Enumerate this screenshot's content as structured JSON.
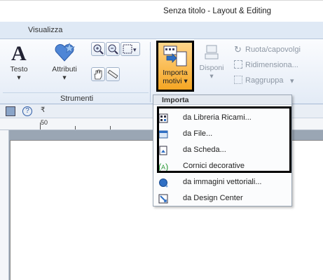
{
  "window": {
    "title": "Senza titolo - Layout & Editing"
  },
  "tabs": {
    "active": "Visualizza"
  },
  "ribbon": {
    "strumenti": {
      "group_label": "Strumenti",
      "testo_label": "Testo",
      "attributi_label": "Attributi"
    },
    "importa": {
      "label_line1": "Importa",
      "label_line2": "motivi"
    },
    "disponi": {
      "label": "Disponi"
    },
    "ruota_label": "Ruota/capovolgi",
    "ridimensiona_label": "Ridimensiona...",
    "raggruppa_label": "Raggruppa"
  },
  "ruler": {
    "tick_50": "50"
  },
  "menu": {
    "header": "Importa",
    "items": [
      {
        "label": "da Libreria Ricami..."
      },
      {
        "label": "da File..."
      },
      {
        "label": "da Scheda..."
      },
      {
        "label": "Cornici decorative"
      },
      {
        "label": "da immagini vettoriali..."
      },
      {
        "label": "da Design Center"
      }
    ]
  }
}
